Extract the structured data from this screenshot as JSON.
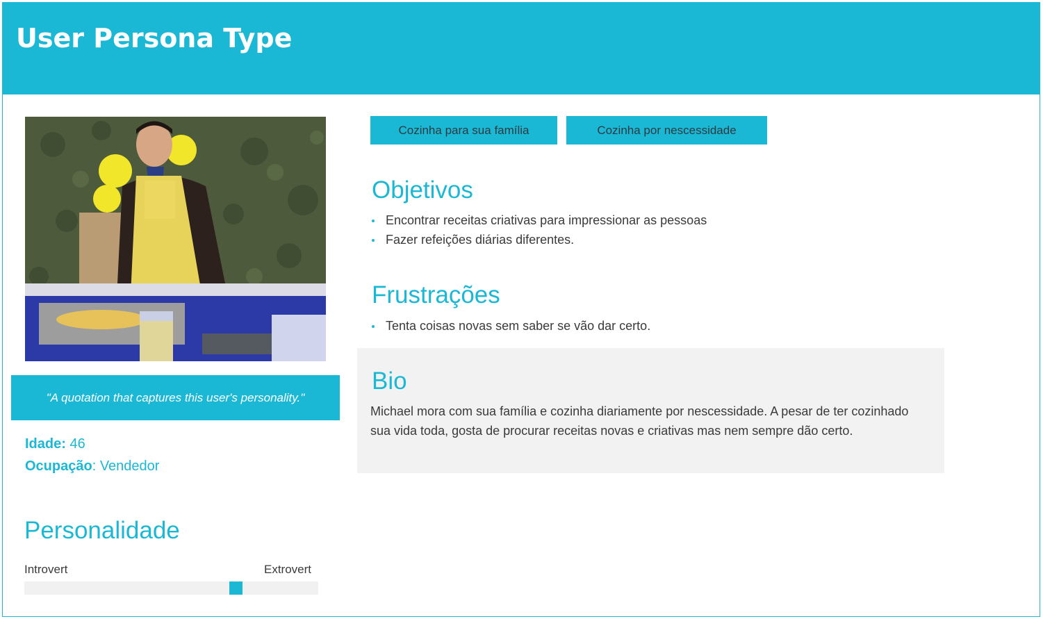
{
  "header": {
    "title": "User Persona Type"
  },
  "photo": {
    "alt": "persona-photo"
  },
  "quote": {
    "text": "\"A quotation that captures this user's personality.\""
  },
  "details": {
    "age_label": "Idade:",
    "age_value": " 46",
    "occupation_label": "Ocupação",
    "occupation_value": ": Vendedor"
  },
  "personality": {
    "title": "Personalidade",
    "left_label": "Introvert",
    "right_label": "Extrovert",
    "level": 0.73
  },
  "tags": [
    "Cozinha para sua família",
    "Cozinha por nescessidade"
  ],
  "goals": {
    "title": "Objetivos",
    "items": [
      "Encontrar receitas criativas para impressionar as pessoas",
      "Fazer refeições diárias diferentes."
    ]
  },
  "frustrations": {
    "title": "Frustrações",
    "items": [
      "Tenta coisas novas sem saber se vão dar certo."
    ]
  },
  "bio": {
    "title": "Bio",
    "text": "Michael mora com sua família e cozinha diariamente por nescessidade. A pesar de ter cozinhado sua vida toda, gosta de procurar receitas novas e criativas mas nem sempre dão certo."
  },
  "colors": {
    "accent": "#1bb8d6",
    "panel": "#f2f2f2"
  }
}
